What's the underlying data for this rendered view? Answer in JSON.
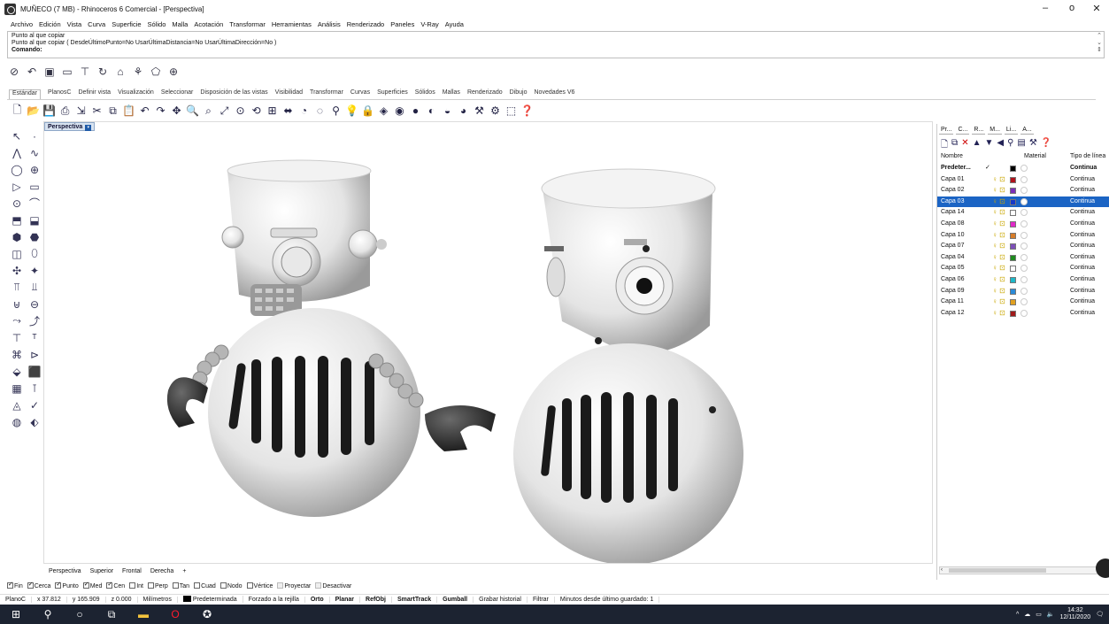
{
  "window": {
    "title": "MUÑECO (7 MB) - Rhinoceros 6 Comercial - [Perspectiva]",
    "minimize": "–",
    "maximize": "ᴏ",
    "close": "✕"
  },
  "menu": [
    "Archivo",
    "Edición",
    "Vista",
    "Curva",
    "Superficie",
    "Sólido",
    "Malla",
    "Acotación",
    "Transformar",
    "Herramientas",
    "Análisis",
    "Renderizado",
    "Paneles",
    "V-Ray",
    "Ayuda"
  ],
  "command": {
    "line1": "Punto al que copiar",
    "line2": "Punto al que copiar ( DesdeÚltimoPunto=No  UsarÚltimaDistancia=No  UsarÚltimaDirección=No )",
    "prompt": "Comando:"
  },
  "toolbar_tabs": [
    "Estándar",
    "PlanosC",
    "Definir vista",
    "Visualización",
    "Seleccionar",
    "Disposición de las vistas",
    "Visibilidad",
    "Transformar",
    "Curvas",
    "Superficies",
    "Sólidos",
    "Mallas",
    "Renderizado",
    "Dibujo",
    "Novedades V6"
  ],
  "viewport": {
    "label": "Perspectiva",
    "tabs": [
      "Perspectiva",
      "Superior",
      "Frontal",
      "Derecha"
    ],
    "add_tab": "+"
  },
  "snaps": [
    {
      "label": "Fin",
      "checked": true
    },
    {
      "label": "Cerca",
      "checked": true
    },
    {
      "label": "Punto",
      "checked": true
    },
    {
      "label": "Med",
      "checked": true
    },
    {
      "label": "Cen",
      "checked": true
    },
    {
      "label": "Int",
      "checked": false
    },
    {
      "label": "Perp",
      "checked": false
    },
    {
      "label": "Tan",
      "checked": false
    },
    {
      "label": "Cuad",
      "checked": false
    },
    {
      "label": "Nodo",
      "checked": false
    },
    {
      "label": "Vértice",
      "checked": false
    },
    {
      "label": "Proyectar",
      "checked": false
    },
    {
      "label": "Desactivar",
      "checked": false
    }
  ],
  "status": {
    "cplane": "PlanoC",
    "x": "x 37.812",
    "y": "y 165.909",
    "z": "z 0.000",
    "units": "Milímetros",
    "layer": "Predeterminada",
    "grid": "Forzado a la rejilla",
    "orto": "Orto",
    "planar": "Planar",
    "refobj": "RefObj",
    "smarttrack": "SmartTrack",
    "gumball": "Gumball",
    "history": "Grabar historial",
    "filter": "Filtrar",
    "saved": "Minutos desde último guardado: 1"
  },
  "panel": {
    "tabs": [
      "Pr...",
      "C...",
      "R...",
      "M...",
      "Li...",
      "A..."
    ],
    "headers": {
      "name": "Nombre",
      "material": "Material",
      "linetype": "Tipo de línea"
    },
    "layers": [
      {
        "name": "Predeter...",
        "color": "#000000",
        "linetype": "Continua",
        "current": true
      },
      {
        "name": "Capa 01",
        "color": "#b0121b",
        "linetype": "Continua"
      },
      {
        "name": "Capa 02",
        "color": "#7b2fb8",
        "linetype": "Continua"
      },
      {
        "name": "Capa 03",
        "color": "#1538c8",
        "linetype": "Continua",
        "selected": true
      },
      {
        "name": "Capa 14",
        "color": "#ffffff",
        "linetype": "Continua"
      },
      {
        "name": "Capa 08",
        "color": "#e028c8",
        "linetype": "Continua"
      },
      {
        "name": "Capa 10",
        "color": "#d77d2a",
        "linetype": "Continua"
      },
      {
        "name": "Capa 07",
        "color": "#7d4fb8",
        "linetype": "Continua"
      },
      {
        "name": "Capa 04",
        "color": "#1f8a1f",
        "linetype": "Continua"
      },
      {
        "name": "Capa 05",
        "color": "#ffffff",
        "linetype": "Continua"
      },
      {
        "name": "Capa 06",
        "color": "#1fb8c8",
        "linetype": "Continua"
      },
      {
        "name": "Capa 09",
        "color": "#2a8ad8",
        "linetype": "Continua"
      },
      {
        "name": "Capa 11",
        "color": "#e0a020",
        "linetype": "Continua"
      },
      {
        "name": "Capa 12",
        "color": "#a01a1a",
        "linetype": "Continua"
      }
    ]
  },
  "taskbar": {
    "time": "14:32",
    "date": "12/11/2020"
  }
}
